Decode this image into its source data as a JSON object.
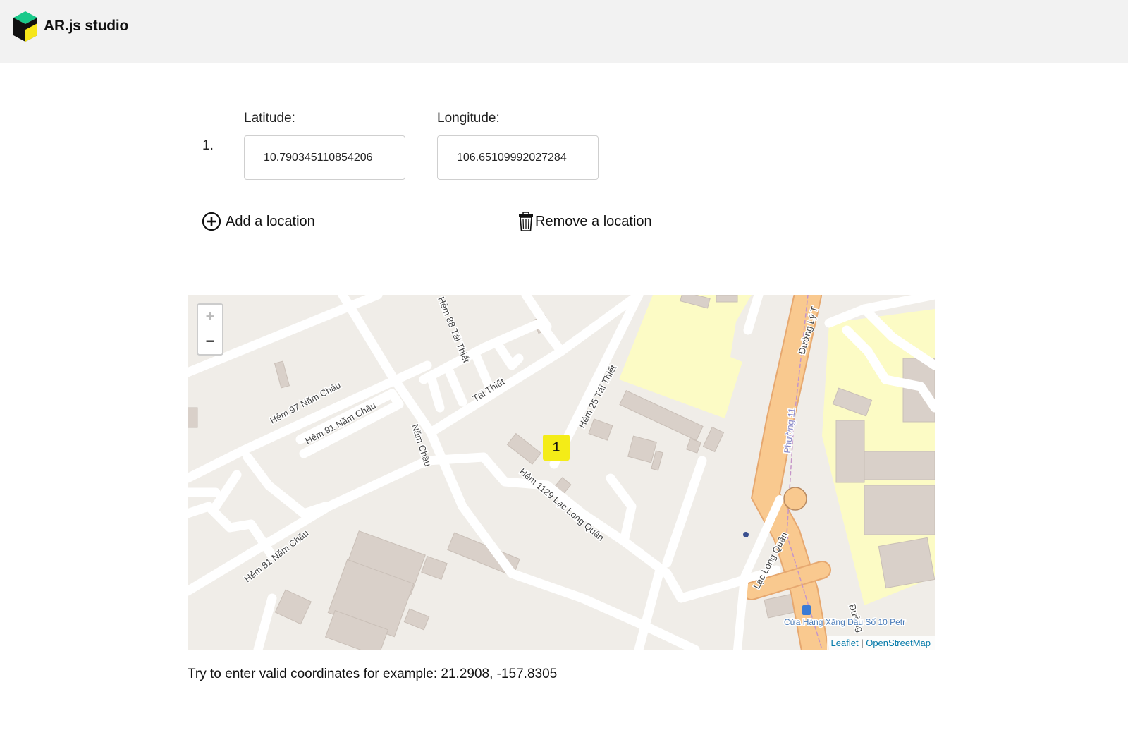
{
  "app": {
    "title": "AR.js studio"
  },
  "locations": [
    {
      "index": "1.",
      "latitude": "10.790345110854206",
      "longitude": "106.65109992027284"
    }
  ],
  "labels": {
    "latitude": "Latitude:",
    "longitude": "Longitude:"
  },
  "actions": {
    "add": "Add a location",
    "remove": "Remove a location"
  },
  "map": {
    "zoom_in": "+",
    "zoom_out": "−",
    "marker_label": "1",
    "attribution": {
      "leaflet": "Leaflet",
      "separator": "|",
      "osm": "OpenStreetMap"
    },
    "street_labels": [
      "Hẻm 97 Năm Châu",
      "Hẻm 91 Năm Châu",
      "Hẻm 88 Tái Thiết",
      "Tái Thiết",
      "Hẻm 25 Tái Thiết",
      "Năm Châu",
      "Hẻm 1129 Lạc Long Quân",
      "Hẻm 81 Năm Châu",
      "Lạc Long Quân",
      "Đường Lý T",
      "Phường 11",
      "Đường",
      "Cửa Hàng Xăng Dầu Số 10 Petr"
    ]
  },
  "hint": "Try to enter valid coordinates for example: 21.2908, -157.8305",
  "colors": {
    "marker": "#f4ec17",
    "major_road": "#f9c98f",
    "park": "#fcfbc5",
    "building": "#d9d0c9",
    "link": "#0078a8"
  }
}
